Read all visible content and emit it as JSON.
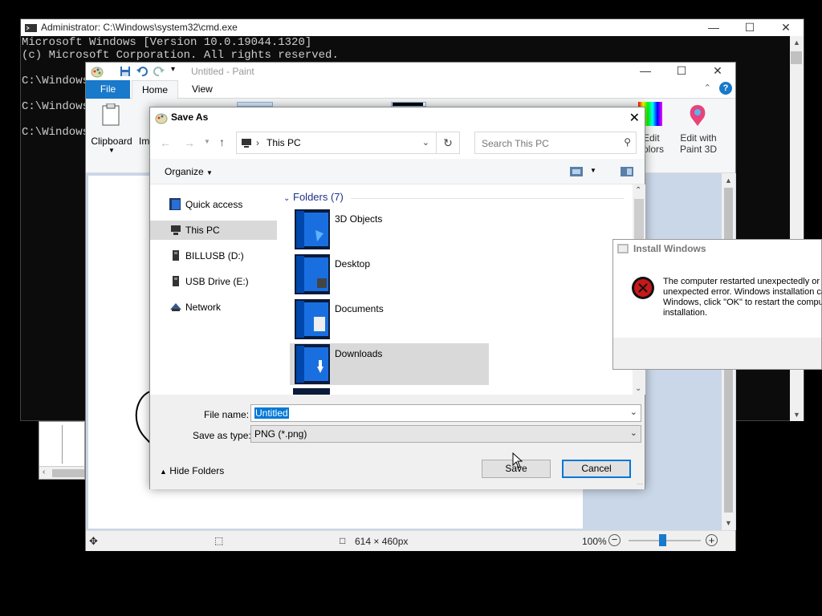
{
  "cmd": {
    "title": "Administrator: C:\\Windows\\system32\\cmd.exe",
    "lines": [
      "Microsoft Windows [Version 10.0.19044.1320]",
      "(c) Microsoft Corporation. All rights reserved.",
      "",
      "C:\\Windows",
      "",
      "C:\\Windows",
      "",
      "C:\\Windows"
    ]
  },
  "paint": {
    "title": "Untitled - Paint",
    "tabs": {
      "file": "File",
      "home": "Home",
      "view": "View"
    },
    "ribbon": {
      "clipboard": "Clipboard",
      "image_partial": "Ima",
      "edit_colors_1": "Edit",
      "edit_colors_2": "olors",
      "paint3d_1": "Edit with",
      "paint3d_2": "Paint 3D"
    },
    "palette": [
      "#000000",
      "#7f7f7f",
      "#880015",
      "#ed1c24",
      "#ff7f27",
      "#fff200",
      "#22b14c",
      "#00a2e8",
      "#3f48cc",
      "#a349a4"
    ],
    "status": {
      "size": "614 × 460px",
      "zoom": "100%"
    }
  },
  "save_as": {
    "title": "Save As",
    "address": {
      "location": "This PC"
    },
    "search_placeholder": "Search This PC",
    "organize": "Organize",
    "nav": [
      "Quick access",
      "This PC",
      "BILLUSB (D:)",
      "USB Drive (E:)",
      "Network"
    ],
    "folders_header": "Folders (7)",
    "folders": [
      "3D Objects",
      "Desktop",
      "Documents",
      "Downloads"
    ],
    "file_name_label": "File name:",
    "file_name_value": "Untitled",
    "save_type_label": "Save as type:",
    "save_type_value": "PNG (*.png)",
    "hide_folders": "Hide Folders",
    "save_button": "Save",
    "cancel_button": "Cancel"
  },
  "install_windows": {
    "title": "Install Windows",
    "message": "The computer restarted unexpectedly or e\nunexpected error. Windows installation ca\nWindows, click \"OK\" to restart the comput\ninstallation."
  }
}
